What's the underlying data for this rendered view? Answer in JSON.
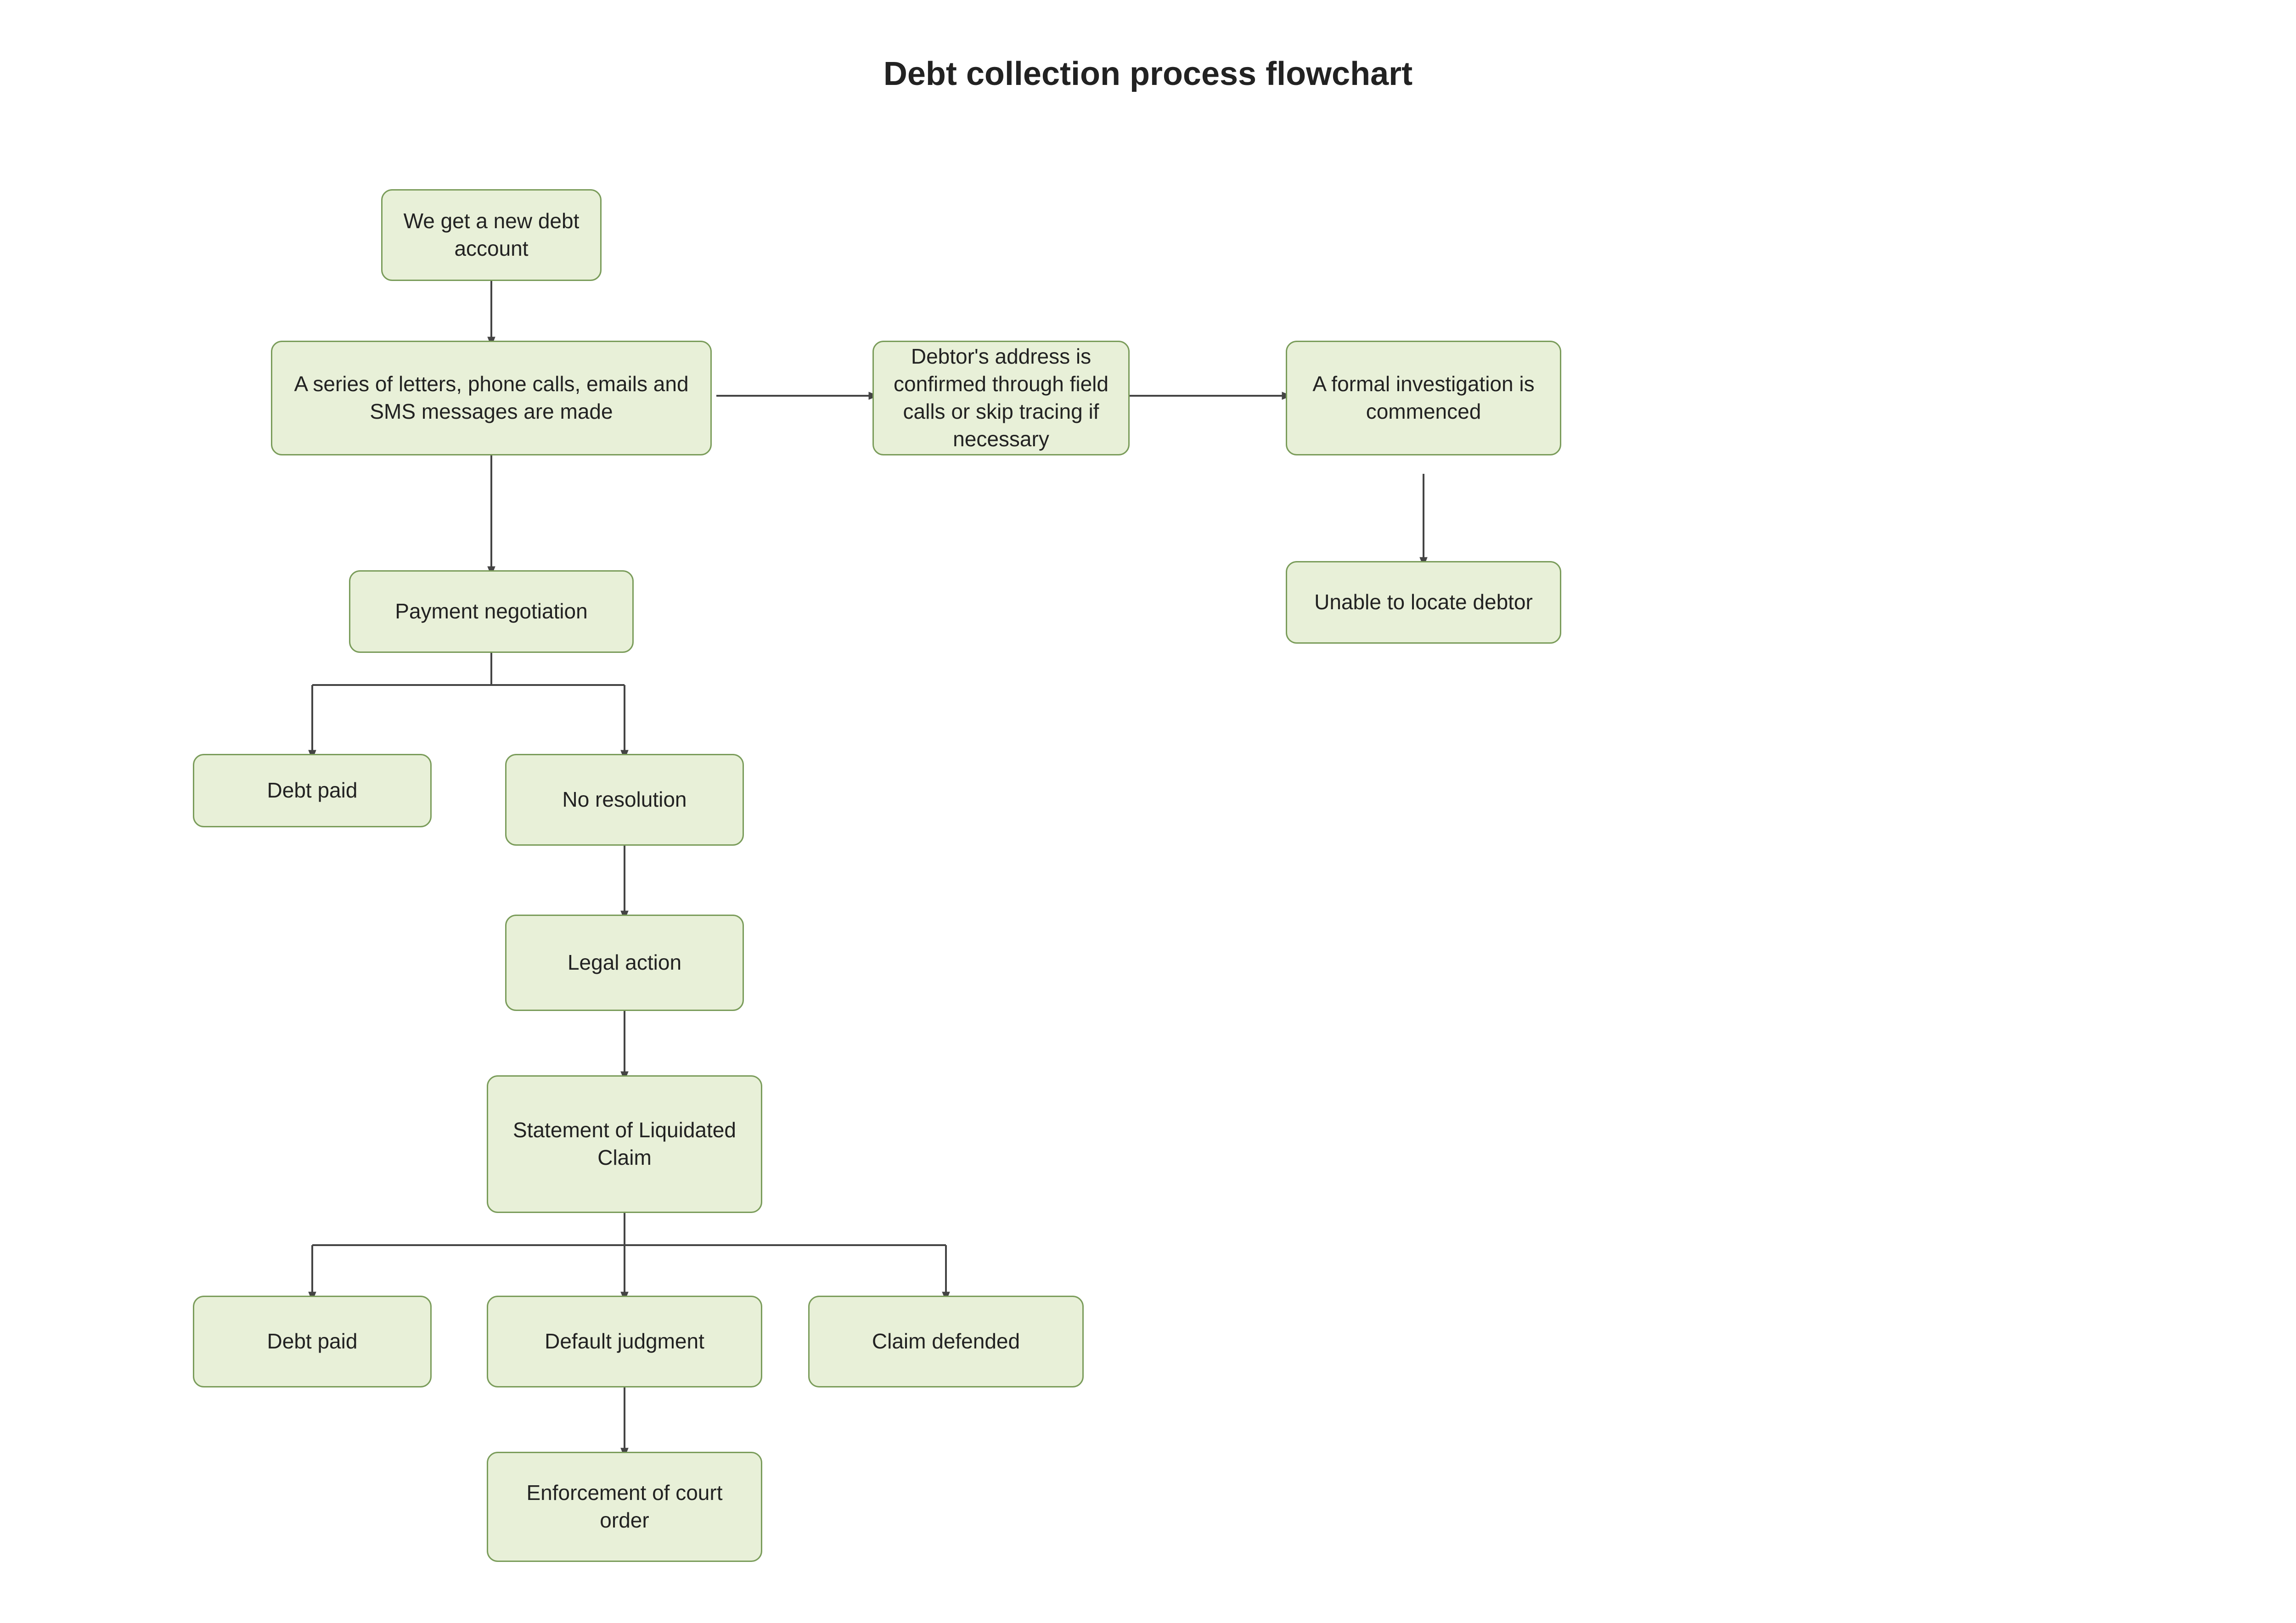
{
  "title": "Debt collection process flowchart",
  "nodes": {
    "new_debt": "We get a new debt account",
    "letters": "A series of letters, phone calls, emails and SMS messages are made",
    "debtor_address": "Debtor's address is confirmed through field calls or skip tracing if necessary",
    "formal_investigation": "A formal investigation is commenced",
    "payment_negotiation": "Payment negotiation",
    "unable_to_locate": "Unable to locate debtor",
    "debt_paid_1": "Debt paid",
    "no_resolution": "No resolution",
    "legal_action": "Legal action",
    "statement_liquidated": "Statement of Liquidated Claim",
    "debt_paid_2": "Debt paid",
    "default_judgment": "Default judgment",
    "claim_defended": "Claim defended",
    "enforcement": "Enforcement of court order"
  }
}
